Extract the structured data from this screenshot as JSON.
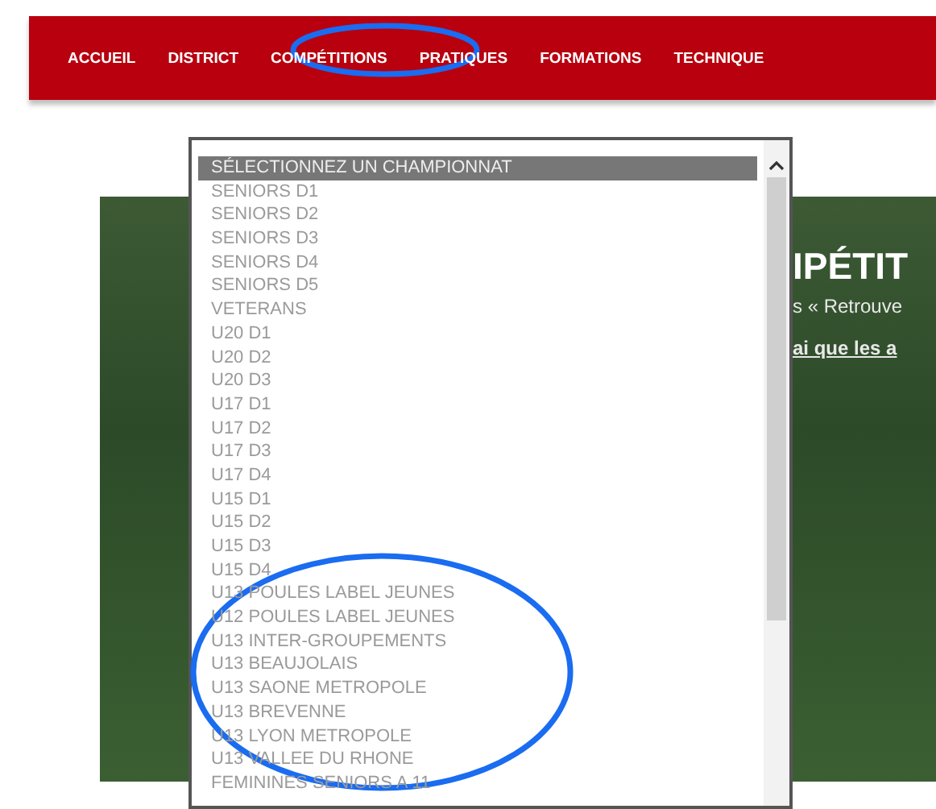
{
  "nav": {
    "items": [
      {
        "label": "ACCUEIL"
      },
      {
        "label": "DISTRICT"
      },
      {
        "label": "COMPÉTITIONS"
      },
      {
        "label": "PRATIQUES"
      },
      {
        "label": "FORMATIONS"
      },
      {
        "label": "TECHNIQUE"
      }
    ]
  },
  "banner": {
    "title": "IPÉTIT",
    "line_1": "s « Retrouve",
    "line_2": "ai que les a"
  },
  "dropdown": {
    "options": [
      {
        "label": "SÉLECTIONNEZ UN CHAMPIONNAT",
        "selected": true
      },
      {
        "label": "SENIORS D1",
        "selected": false
      },
      {
        "label": "SENIORS D2",
        "selected": false
      },
      {
        "label": "SENIORS D3",
        "selected": false
      },
      {
        "label": "SENIORS D4",
        "selected": false
      },
      {
        "label": "SENIORS D5",
        "selected": false
      },
      {
        "label": "VETERANS",
        "selected": false
      },
      {
        "label": "U20 D1",
        "selected": false
      },
      {
        "label": "U20 D2",
        "selected": false
      },
      {
        "label": "U20 D3",
        "selected": false
      },
      {
        "label": "U17 D1",
        "selected": false
      },
      {
        "label": "U17 D2",
        "selected": false
      },
      {
        "label": "U17 D3",
        "selected": false
      },
      {
        "label": "U17 D4",
        "selected": false
      },
      {
        "label": "U15 D1",
        "selected": false
      },
      {
        "label": "U15 D2",
        "selected": false
      },
      {
        "label": "U15 D3",
        "selected": false
      },
      {
        "label": "U15 D4",
        "selected": false
      },
      {
        "label": "U13 POULES LABEL JEUNES",
        "selected": false
      },
      {
        "label": "U12 POULES LABEL JEUNES",
        "selected": false
      },
      {
        "label": "U13 INTER-GROUPEMENTS",
        "selected": false
      },
      {
        "label": "U13 BEAUJOLAIS",
        "selected": false
      },
      {
        "label": "U13 SAONE METROPOLE",
        "selected": false
      },
      {
        "label": "U13 BREVENNE",
        "selected": false
      },
      {
        "label": "U13 LYON METROPOLE",
        "selected": false
      },
      {
        "label": "U13 VALLEE DU RHONE",
        "selected": false
      },
      {
        "label": "FEMININES SENIORS A 11",
        "selected": false
      }
    ]
  }
}
